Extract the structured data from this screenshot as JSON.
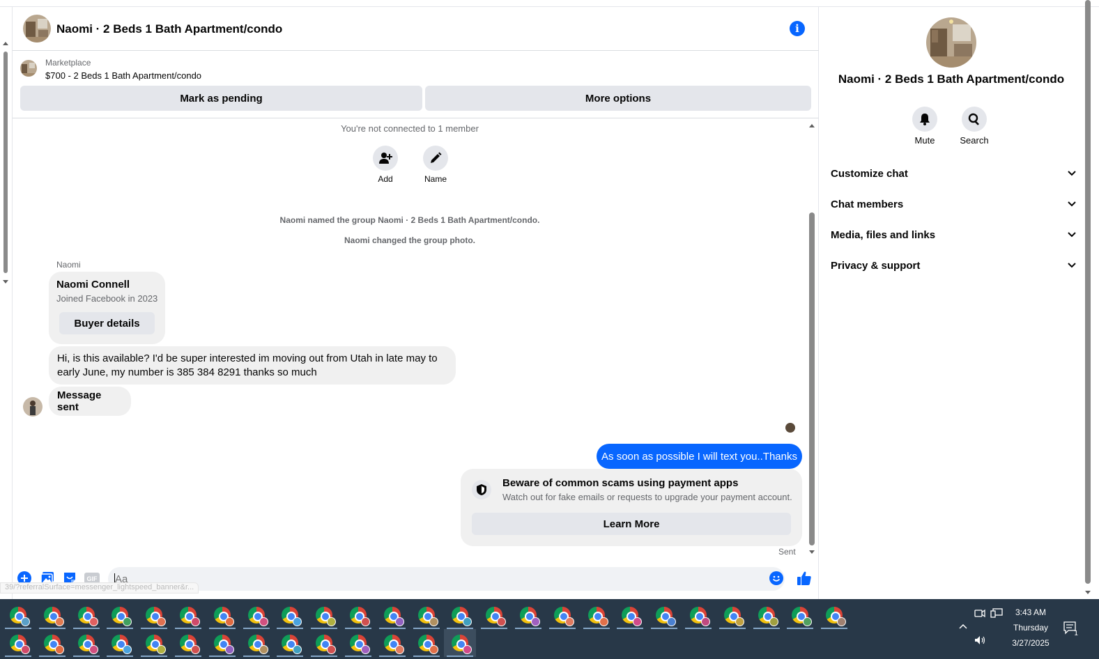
{
  "header": {
    "title": "Naomi · 2 Beds 1 Bath Apartment/condo"
  },
  "marketplace": {
    "label": "Marketplace",
    "listing": "$700 - 2 Beds 1 Bath Apartment/condo",
    "mark_pending": "Mark as pending",
    "more_options": "More options"
  },
  "conversation": {
    "not_connected": "You're not connected to 1 member",
    "actions": [
      {
        "label": "Add",
        "icon": "add-person-icon"
      },
      {
        "label": "Name",
        "icon": "pencil-icon"
      }
    ],
    "system_notes": [
      "Naomi named the group Naomi · 2 Beds 1 Bath Apartment/condo.",
      "Naomi changed the group photo."
    ],
    "sender": "Naomi",
    "profile_card": {
      "name": "Naomi Connell",
      "subtitle": "Joined Facebook in 2023",
      "button": "Buyer details"
    },
    "incoming_message": "Hi, is this available? I'd be super interested im moving out from Utah in late may to early June, my number is 385 384 8291 thanks so much",
    "incoming_status": "Message sent",
    "outgoing_message": "As soon as possible I will text you..Thanks",
    "scam_notice": {
      "title": "Beware of common scams using payment apps",
      "subtitle": "Watch out for fake emails or requests to upgrade your payment account.",
      "button": "Learn More"
    },
    "delivery_status": "Sent"
  },
  "composer": {
    "placeholder": "Aa",
    "icons": [
      "plus-icon",
      "image-icon",
      "sticker-icon",
      "gif-icon",
      "emoji-icon",
      "like-icon"
    ],
    "gif_label": "GIF",
    "status_url": "39/?referralSurface=messenger_lightspeed_banner&r..."
  },
  "sidebar": {
    "title": "Naomi · 2 Beds 1 Bath Apartment/condo",
    "quick_actions": [
      {
        "label": "Mute",
        "icon": "bell-icon"
      },
      {
        "label": "Search",
        "icon": "search-icon"
      }
    ],
    "sections": [
      {
        "label": "Customize chat"
      },
      {
        "label": "Chat members"
      },
      {
        "label": "Media, files and links"
      },
      {
        "label": "Privacy & support"
      }
    ]
  },
  "taskbar": {
    "time": "3:43 AM",
    "day": "Thursday",
    "date": "3/27/2025",
    "notification_count": "1",
    "colors": {
      "accent": "#0866ff",
      "taskbar_bg": "#283848"
    }
  }
}
